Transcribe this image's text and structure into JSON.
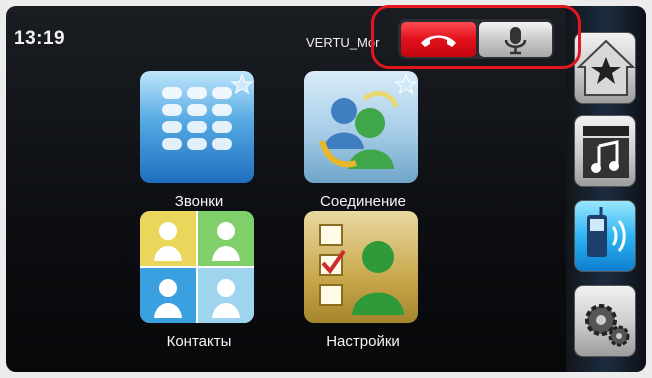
{
  "status": {
    "time": "13:19",
    "device_name": "VERTU_Mor"
  },
  "call_controls": {
    "hangup_icon": "phone-hangup-icon",
    "mic_icon": "microphone-icon"
  },
  "apps": [
    {
      "label": "Звонки",
      "icon": "dialpad-icon"
    },
    {
      "label": "Соединение",
      "icon": "connection-icon"
    },
    {
      "label": "Контакты",
      "icon": "contacts-icon"
    },
    {
      "label": "Настройки",
      "icon": "settings-icon"
    }
  ],
  "dock": [
    "favorites-icon",
    "media-icon",
    "phone-icon",
    "gear-icon"
  ],
  "colors": {
    "highlight": "#e1161e",
    "hangup": "#e0101b",
    "phone_active": "#2db4f2"
  }
}
